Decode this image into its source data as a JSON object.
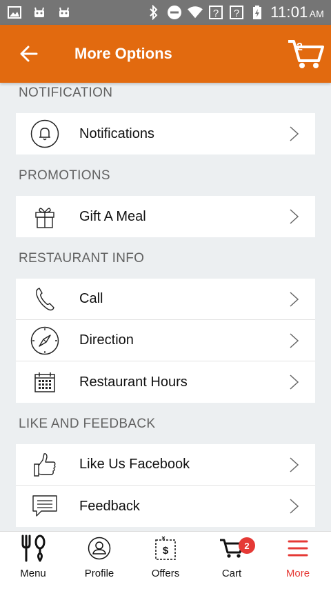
{
  "status_bar": {
    "time": "11:01",
    "ampm": "AM"
  },
  "app_bar": {
    "title": "More Options",
    "cart_count": "2"
  },
  "sections": [
    {
      "title": "NOTIFICATION",
      "items": [
        {
          "label": "Notifications",
          "icon": "bell-icon"
        }
      ]
    },
    {
      "title": "PROMOTIONS",
      "items": [
        {
          "label": "Gift A Meal",
          "icon": "gift-icon"
        }
      ]
    },
    {
      "title": "RESTAURANT INFO",
      "items": [
        {
          "label": "Call",
          "icon": "phone-icon"
        },
        {
          "label": "Direction",
          "icon": "compass-icon"
        },
        {
          "label": "Restaurant Hours",
          "icon": "calendar-icon"
        }
      ]
    },
    {
      "title": "LIKE AND FEEDBACK",
      "items": [
        {
          "label": "Like Us Facebook",
          "icon": "thumbs-up-icon"
        },
        {
          "label": "Feedback",
          "icon": "message-icon"
        }
      ]
    }
  ],
  "bottom_nav": {
    "tabs": [
      {
        "label": "Menu",
        "icon": "fork-spoon-icon"
      },
      {
        "label": "Profile",
        "icon": "profile-icon"
      },
      {
        "label": "Offers",
        "icon": "coupon-icon"
      },
      {
        "label": "Cart",
        "icon": "cart-icon",
        "badge": "2"
      },
      {
        "label": "More",
        "icon": "hamburger-icon",
        "active": true
      }
    ]
  },
  "colors": {
    "primary": "#e26a0f",
    "active": "#e53935",
    "background": "#eceff1"
  }
}
